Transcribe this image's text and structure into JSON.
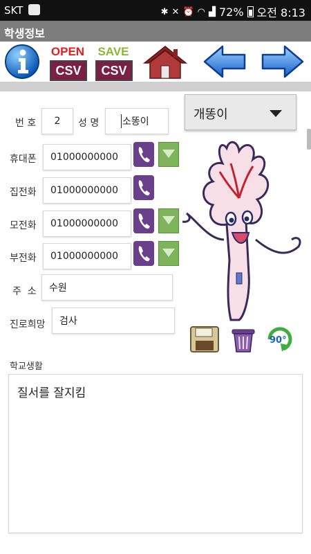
{
  "status_bar": {
    "carrier": "SKT",
    "battery": "72%",
    "time": "오전 8:13"
  },
  "title": "학생정보",
  "toolbar": {
    "open_top": "OPEN",
    "open_bottom": "CSV",
    "save_top": "SAVE",
    "save_bottom": "CSV"
  },
  "colors": {
    "open_label": "#e02020",
    "save_label": "#8ab833",
    "csv_box": "#7b1f45",
    "phone_button": "#6a3f8c",
    "sms_button": "#7fb55a"
  },
  "form": {
    "number_label": "번 호",
    "number_value": "2",
    "name_label": "성 명",
    "name_value": "소똥이",
    "mobile_label": "휴대폰",
    "mobile_value": "01000000000",
    "home_label": "집전화",
    "home_value": "01000000000",
    "mother_label": "모전화",
    "mother_value": "01000000000",
    "father_label": "부전화",
    "father_value": "01000000000",
    "address_label": "주  소",
    "address_value": "수원",
    "career_label": "진로희망",
    "career_value": "검사"
  },
  "student_select": {
    "selected": "개똥이"
  },
  "photo_tools": {
    "rotate_label": "90°"
  },
  "notes": {
    "label": "학교생활",
    "value": "질서를 잘지킴"
  }
}
